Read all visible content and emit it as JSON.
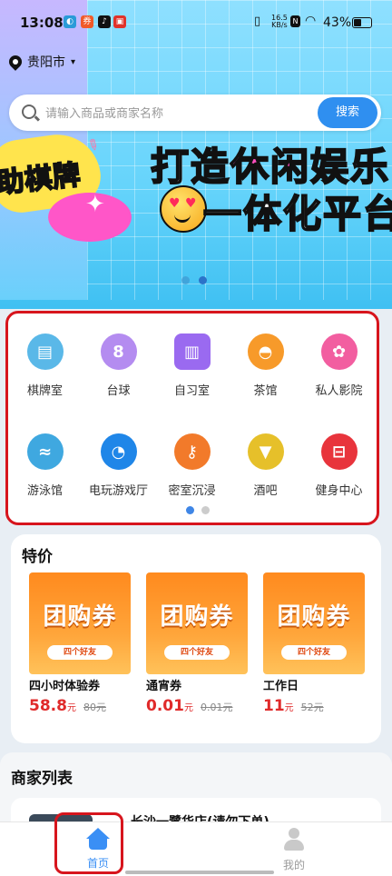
{
  "status_bar": {
    "time": "13:08",
    "network_speed_value": "16.5",
    "network_speed_unit": "KB/s",
    "battery": "43%",
    "battery_level": 0.43
  },
  "location": {
    "city": "贵阳市"
  },
  "search": {
    "placeholder": "请输入商品或商家名称",
    "button": "搜索"
  },
  "banner": {
    "left_slogan": "助棋牌",
    "slogan_line1_a": "打造",
    "slogan_line1_b": "休闲娱乐",
    "slogan_line2": "一体化平台",
    "page_count": 2,
    "active_page": 0
  },
  "categories": {
    "row1": [
      {
        "label": "棋牌室",
        "icon": "card-table-icon",
        "color": "#5ab8e8"
      },
      {
        "label": "台球",
        "icon": "billiards-icon",
        "color": "#b48cf0"
      },
      {
        "label": "自习室",
        "icon": "book-icon",
        "color": "#9a6af0"
      },
      {
        "label": "茶馆",
        "icon": "teapot-icon",
        "color": "#f79a2a"
      },
      {
        "label": "私人影院",
        "icon": "film-reel-icon",
        "color": "#f25ea0"
      }
    ],
    "row2": [
      {
        "label": "游泳馆",
        "icon": "swimming-icon",
        "color": "#3fa8e0"
      },
      {
        "label": "电玩游戏厅",
        "icon": "game-icon",
        "color": "#1f86e8"
      },
      {
        "label": "密室沉浸",
        "icon": "key-icon",
        "color": "#f27a2a"
      },
      {
        "label": "酒吧",
        "icon": "cocktail-icon",
        "color": "#e6c02a"
      },
      {
        "label": "健身中心",
        "icon": "dumbbell-icon",
        "color": "#e8343c"
      }
    ],
    "page_count": 2,
    "active_page": 0
  },
  "deals": {
    "title": "特价",
    "items": [
      {
        "coupon_text": "团购券",
        "brand": "四个好友",
        "name": "四小时体验券",
        "price": "58.8",
        "unit": "元",
        "original_price": "80元"
      },
      {
        "coupon_text": "团购券",
        "brand": "四个好友",
        "name": "通宵券",
        "price": "0.01",
        "unit": "元",
        "original_price": "0.01元"
      },
      {
        "coupon_text": "团购券",
        "brand": "四个好友",
        "name": "工作日",
        "price": "11",
        "unit": "元",
        "original_price": "52元"
      }
    ]
  },
  "merchants": {
    "title": "商家列表",
    "first_name": "长沙一鹭华店(请勿下单)"
  },
  "tabbar": {
    "home": "首页",
    "mine": "我的"
  },
  "colors": {
    "accent": "#2f8ff0",
    "price": "#e02a2a",
    "highlight": "#d7151d"
  }
}
